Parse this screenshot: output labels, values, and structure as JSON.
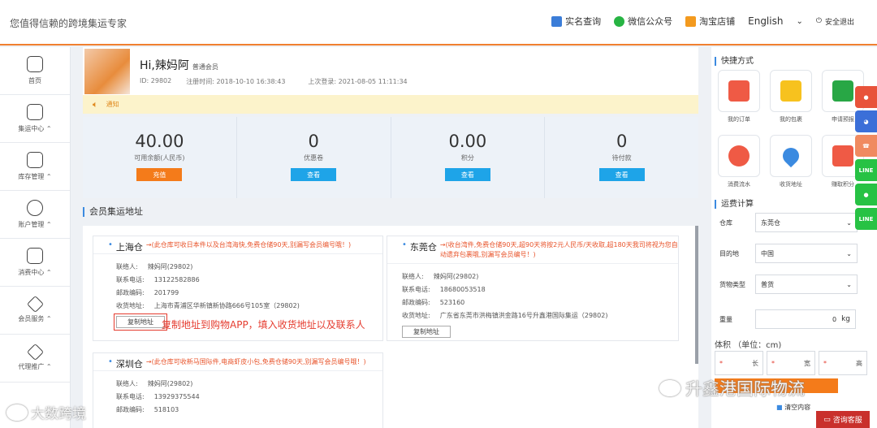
{
  "header": {
    "tagline": "您值得信赖的跨境集运专家",
    "links": [
      {
        "label": "实名查询",
        "icon": "id-card-icon"
      },
      {
        "label": "微信公众号",
        "icon": "wechat-icon"
      },
      {
        "label": "淘宝店铺",
        "icon": "taobao-icon"
      }
    ],
    "language": "English",
    "logout": "安全退出"
  },
  "sidebar": {
    "items": [
      {
        "label": "首页",
        "icon": "home-icon"
      },
      {
        "label": "集运中心",
        "icon": "box-icon"
      },
      {
        "label": "库存管理",
        "icon": "inventory-icon"
      },
      {
        "label": "账户管理",
        "icon": "user-icon"
      },
      {
        "label": "消费中心",
        "icon": "card-icon"
      },
      {
        "label": "会员服务",
        "icon": "diamond-icon"
      },
      {
        "label": "代理推广",
        "icon": "diamond-icon"
      }
    ]
  },
  "profile": {
    "greeting": "Hi,辣妈阿",
    "level": "普通会员",
    "id": "ID: 29802",
    "registered": "注册时间: 2018-10-10 16:38:43",
    "last_login": "上次登录: 2021-08-05 11:11:34"
  },
  "notice": {
    "label": "通知"
  },
  "stats": [
    {
      "value": "40.00",
      "label": "可用余额(人民币)",
      "button": "充值"
    },
    {
      "value": "0",
      "label": "优惠卷",
      "button": "查看"
    },
    {
      "value": "0.00",
      "label": "积分",
      "button": "查看"
    },
    {
      "value": "0",
      "label": "待付款",
      "button": "查看"
    }
  ],
  "address_section": {
    "title": "会员集运地址"
  },
  "warehouses": [
    {
      "name": "上海仓",
      "note": "→(此仓库可收日本件以及台湾海快,免费仓储90天,别漏写会员编号哦！)",
      "contact_label": "联络人:",
      "contact": "辣妈阿(29802)",
      "phone_label": "联系电话:",
      "phone": "13122582886",
      "zip_label": "邮政编码:",
      "zip": "201799",
      "address_label": "收货地址:",
      "address": "上海市青浦区华新镇新协路666号105室（29802)",
      "copy": "复制地址"
    },
    {
      "name": "东莞仓",
      "note": "→(收台湾件,免费仓储90天,超90天将按2元人民币/天收取,超180天我司将视为您自动遗弃包裹哦,别漏写会员编号！)",
      "contact_label": "联络人:",
      "contact": "辣妈阿(29802)",
      "phone_label": "联系电话:",
      "phone": "18680053518",
      "zip_label": "邮政编码:",
      "zip": "523160",
      "address_label": "收货地址:",
      "address": "广东省东莞市洪梅镇洪金路16号升鑫港国际集运（29802)",
      "copy": "复制地址"
    },
    {
      "name": "深圳仓",
      "note": "→(此仓库可收新马国际件,电商虾皮小包,免费仓储90天,别漏写会员编号哦！)",
      "contact_label": "联络人:",
      "contact": "辣妈阿(29802)",
      "phone_label": "联系电话:",
      "phone": "13929375544",
      "zip_label": "邮政编码:",
      "zip": "518103"
    }
  ],
  "annotation": "复制地址到购物APP，填入收货地址以及联系人",
  "quick": {
    "title": "快捷方式",
    "items": [
      {
        "label": "我的订单",
        "icon": "order-icon"
      },
      {
        "label": "我的包裹",
        "icon": "package-icon"
      },
      {
        "label": "申请预报",
        "icon": "truck-icon"
      },
      {
        "label": "消费流水",
        "icon": "pie-chart-icon"
      },
      {
        "label": "收货地址",
        "icon": "location-pin-icon"
      },
      {
        "label": "赚取积分",
        "icon": "gift-icon"
      }
    ]
  },
  "calculator": {
    "title": "运费计算",
    "warehouse_label": "仓库",
    "warehouse": "东莞仓",
    "destination_label": "目的地",
    "destination": "中国",
    "type_label": "货物类型",
    "type": "普货",
    "weight_label": "重量",
    "weight": "0",
    "weight_unit": "kg",
    "volume_title": "体积 （单位：cm)",
    "length": "长",
    "width": "宽",
    "height": "高",
    "clear": "清空内容"
  },
  "float_icons": [
    "qq-icon",
    "chat-icon",
    "phone-icon",
    "line-icon",
    "wechat-icon",
    "line-icon"
  ],
  "float_line": "LINE",
  "consult": "咨询客服",
  "watermark_right": "升鑫港国际物流",
  "watermark_left": "大数跨境"
}
